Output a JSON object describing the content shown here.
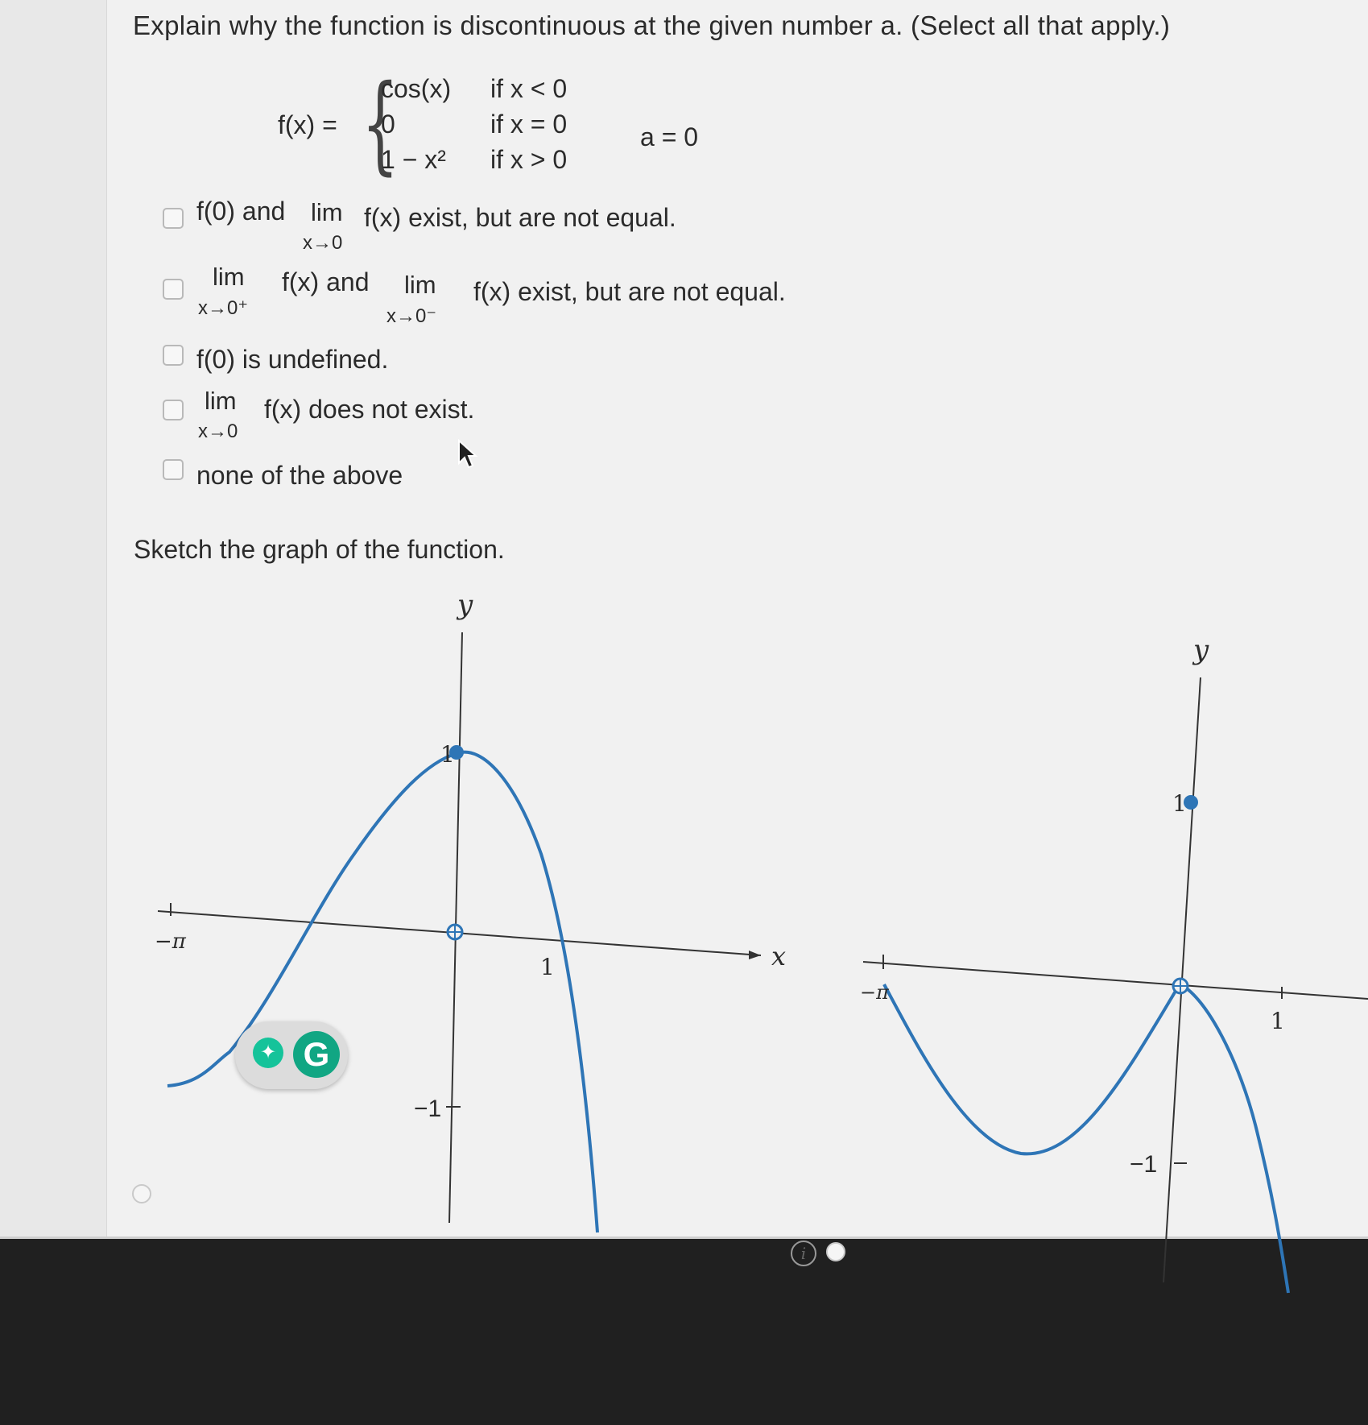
{
  "question": {
    "text": "Explain why the function is discontinuous at the given number a. (Select all that apply.)"
  },
  "formula": {
    "lhs": "f(x) =",
    "rows": [
      {
        "expr": "cos(x)",
        "cond": "if x < 0"
      },
      {
        "expr": "0",
        "cond": "if x = 0"
      },
      {
        "expr": "1 − x²",
        "cond": "if x > 0"
      }
    ],
    "a_value": "a = 0"
  },
  "options": [
    {
      "pre": "f(0) and",
      "lim": "lim",
      "sub": "x→0",
      "post": "f(x) exist, but are not equal."
    },
    {
      "lim1": "lim",
      "sub1": "x→0⁺",
      "mid": "f(x) and",
      "lim2": "lim",
      "sub2": "x→0⁻",
      "post": "f(x) exist, but are not equal."
    },
    {
      "text": "f(0) is undefined."
    },
    {
      "lim": "lim",
      "sub": "x→0",
      "post": "f(x) does not exist."
    },
    {
      "text": "none of the above"
    }
  ],
  "sketch_prompt": "Sketch the graph of the function.",
  "graph1": {
    "y_label": "y",
    "x_label": "x",
    "tick_neg_pi": "−π",
    "tick_one_y": "1",
    "tick_one_x": "1",
    "tick_neg_one": "−1"
  },
  "graph2": {
    "y_label": "y",
    "tick_neg_pi": "−π",
    "tick_one_y": "1",
    "tick_one_x": "1",
    "tick_neg_one": "−1"
  },
  "overlay": {
    "grammarly_letter": "G",
    "bulb_symbol": "✦",
    "info_symbol": "i"
  },
  "colors": {
    "curve": "#2e75b6",
    "text": "#2b2b2b"
  }
}
